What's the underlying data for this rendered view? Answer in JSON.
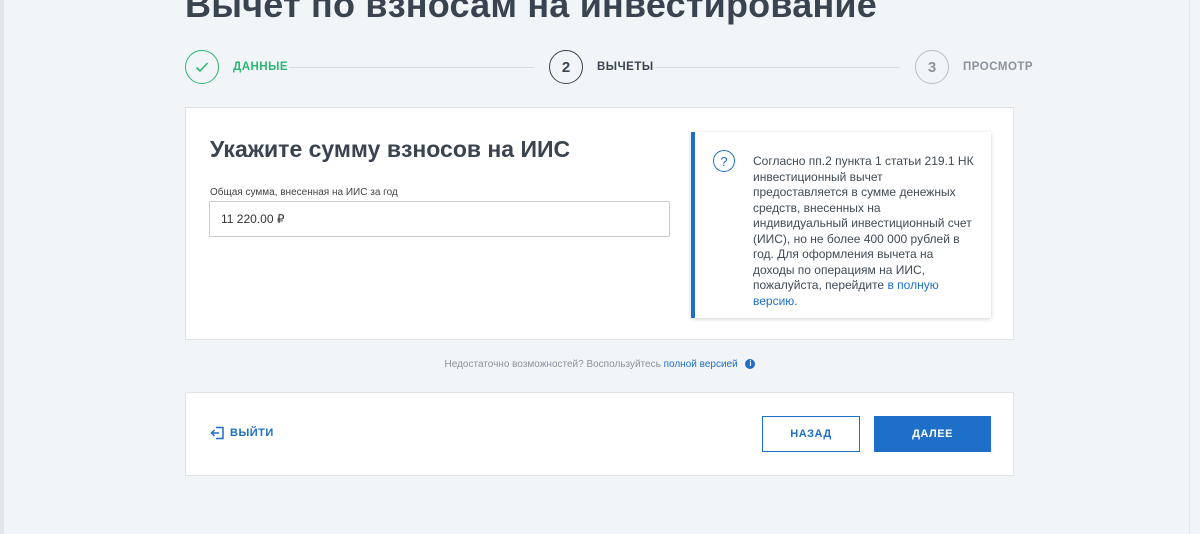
{
  "page": {
    "title": "Вычет по взносам на инвестирование"
  },
  "stepper": {
    "steps": [
      {
        "number": "✓",
        "label": "ДАННЫЕ",
        "state": "done"
      },
      {
        "number": "2",
        "label": "ВЫЧЕТЫ",
        "state": "active"
      },
      {
        "number": "3",
        "label": "ПРОСМОТР",
        "state": "pending"
      }
    ]
  },
  "form": {
    "heading": "Укажите сумму взносов на ИИС",
    "amount_label": "Общая сумма, внесенная на ИИС за год",
    "amount_value": "11 220.00 ₽"
  },
  "info": {
    "icon": "question-icon",
    "text": "Согласно пп.2 пункта 1 статьи 219.1 НК инвестиционный вычет предоставляется в сумме денежных средств, внесенных на индивидуальный инвестиционный счет (ИИС), но не более 400 000 рублей в год. Для оформления вычета на доходы по операциям на ИИС, пожалуйста, перейдите",
    "link_text": "в полную версию",
    "link_suffix": "."
  },
  "hint": {
    "text": "Недостаточно возможностей? Воспользуйтесь",
    "link_text": "полной версией",
    "icon": "info-icon"
  },
  "footer": {
    "exit_label": "ВЫЙТИ",
    "back_label": "НАЗАД",
    "next_label": "ДАЛЕЕ"
  },
  "colors": {
    "accent": "#1d6fc7",
    "success": "#2bb673",
    "background": "#f1f5f8"
  }
}
